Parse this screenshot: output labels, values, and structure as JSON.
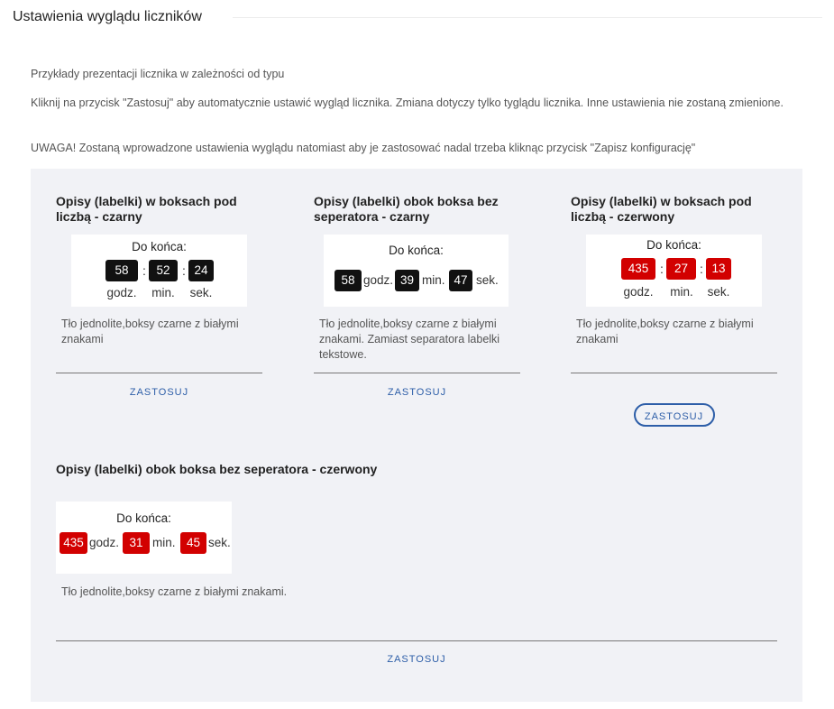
{
  "header": {
    "title": "Ustawienia wyglądu liczników"
  },
  "intro": {
    "line1": "Przykłady prezentacji licznika w zależności od typu",
    "line2": "Kliknij na przycisk \"Zastosuj\" aby automatycznie ustawić wygląd licznika. Zmiana dotyczy tylko tyglądu licznika. Inne ustawienia nie zostaną zmienione.",
    "line3": "UWAGA! Zostaną wprowadzone ustawienia wyglądu natomiast aby je zastosować nadal trzeba kliknąc przycisk \"Zapisz konfigurację\""
  },
  "colors": {
    "black_box": "#111111",
    "red_box": "#d20000",
    "link": "#2d5ea8",
    "panel": "#f1f2f6"
  },
  "cards": [
    {
      "title": "Opisy (labelki) w boksach pod liczbą - czarny",
      "preview": {
        "label": "Do końca:",
        "values": [
          "58",
          "52",
          "24"
        ],
        "separator": ":",
        "units": [
          "godz.",
          "min.",
          "sek."
        ]
      },
      "description": "Tło jednolite,boksy czarne z białymi znakami",
      "button": "ZASTOSUJ"
    },
    {
      "title": "Opisy (labelki) obok boksa bez seperatora - czarny",
      "preview": {
        "label": "Do końca:",
        "values": [
          "58",
          "39",
          "47"
        ],
        "units": [
          "godz.",
          "min.",
          "sek."
        ]
      },
      "description": "Tło jednolite,boksy czarne z białymi znakami. Zamiast separatora labelki tekstowe.",
      "button": "ZASTOSUJ"
    },
    {
      "title": "Opisy (labelki) w boksach pod liczbą - czerwony",
      "preview": {
        "label": "Do końca:",
        "values": [
          "435",
          "27",
          "13"
        ],
        "separator": ":",
        "units": [
          "godz.",
          "min.",
          "sek."
        ]
      },
      "description": "Tło jednolite,boksy czarne z białymi znakami",
      "button": "ZASTOSUJ"
    },
    {
      "title": "Opisy (labelki) obok boksa bez seperatora - czerwony",
      "preview": {
        "label": "Do końca:",
        "values": [
          "435",
          "31",
          "45"
        ],
        "units": [
          "godz.",
          "min.",
          "sek."
        ]
      },
      "description": "Tło jednolite,boksy czarne z białymi znakami.",
      "button": "ZASTOSUJ"
    }
  ]
}
